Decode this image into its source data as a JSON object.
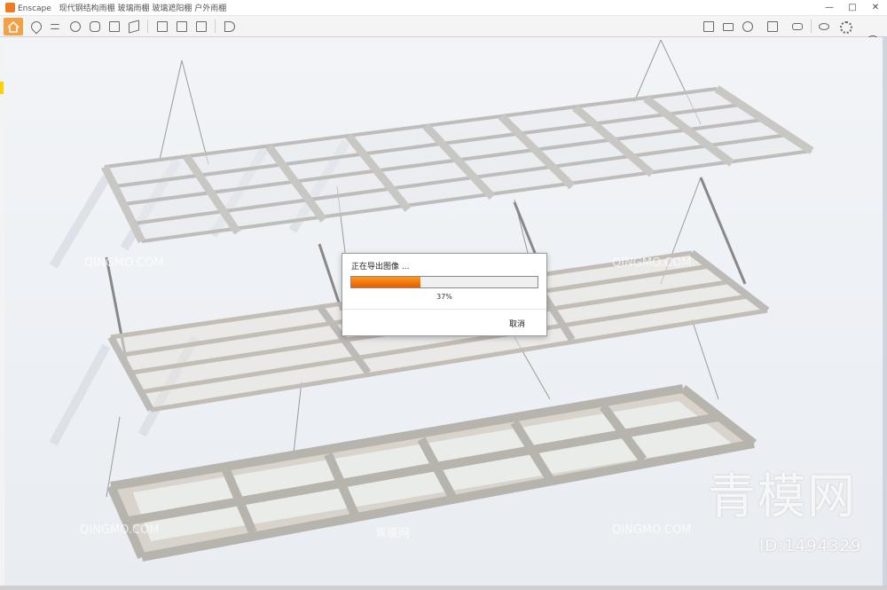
{
  "window": {
    "app_name": "Enscape",
    "title_suffix": "现代钢结构雨棚 玻璃雨棚 玻璃遮阳棚 户外雨棚"
  },
  "window_controls": [
    "—",
    "□",
    "✕"
  ],
  "toolbar": {
    "left_icons": [
      "home-icon",
      "pin-icon",
      "list-icon",
      "camera-path-icon",
      "binoculars-icon",
      "buildings-icon",
      "cube-icon",
      "screenshot-icon",
      "batch-render-icon",
      "export-icon",
      "forward-icon"
    ],
    "right_icons": [
      "asset-library-icon",
      "panorama-icon",
      "visual-settings-icon",
      "materials-icon",
      "vr-icon",
      "sync-icon",
      "eye-icon",
      "settings-icon"
    ],
    "help_label": "?"
  },
  "dialog": {
    "title": "正在导出图像 ...",
    "progress_percent": 37,
    "progress_label": "37%",
    "cancel_label": "取消",
    "fill_color": "#ff7a00"
  },
  "watermark": {
    "brand_cn": "青模网",
    "brand_latin": "QINGMO.COM",
    "id_label": "ID:1494329"
  }
}
